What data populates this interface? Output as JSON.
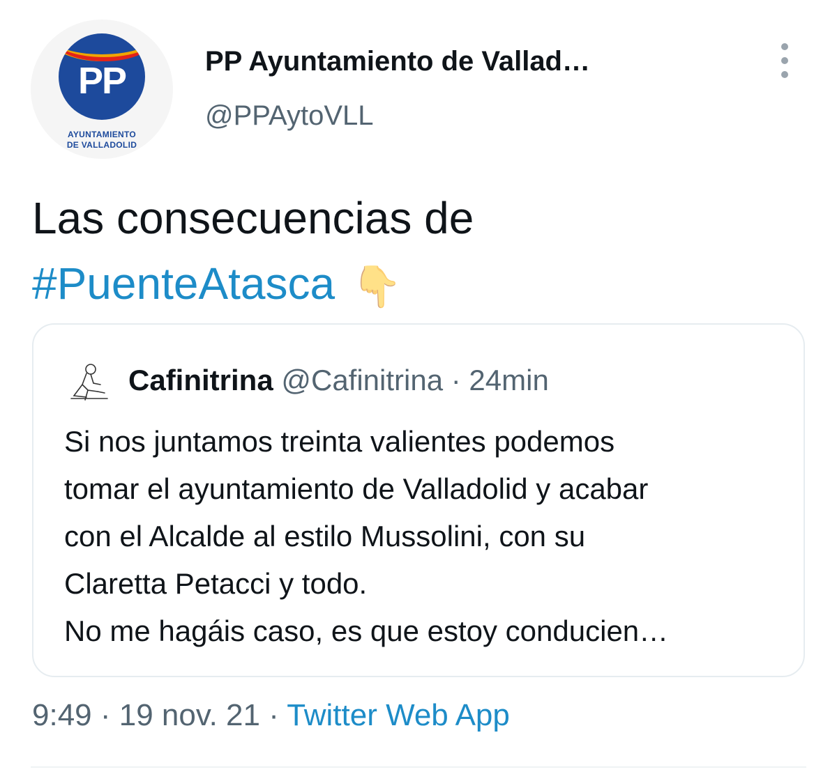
{
  "author": {
    "display_name": "PP Ayuntamiento de Vallad…",
    "handle": "@PPAytoVLL",
    "avatar_logo_text": "PP",
    "avatar_caption_line1": "AYUNTAMIENTO",
    "avatar_caption_line2": "DE VALLADOLID"
  },
  "tweet": {
    "text_line1": "Las consecuencias de",
    "hashtag": "#PuenteAtasca",
    "emoji": "👇"
  },
  "quoted": {
    "name": "Cafinitrina",
    "handle": "@Cafinitrina",
    "separator": " · ",
    "time": "24min",
    "lines": [
      "Si nos juntamos treinta valientes podemos",
      "tomar el ayuntamiento de Valladolid y acabar",
      "con el Alcalde al estilo Mussolini, con su",
      "Claretta Petacci y todo.",
      "No me hagáis caso, es que estoy conducien…"
    ]
  },
  "footer": {
    "time": "9:49",
    "sep1": " · ",
    "date": "19 nov. 21",
    "sep2": " · ",
    "source": "Twitter Web App"
  },
  "colors": {
    "link": "#1d8cc8",
    "muted": "#536471",
    "brand_blue": "#1d4a9c"
  }
}
